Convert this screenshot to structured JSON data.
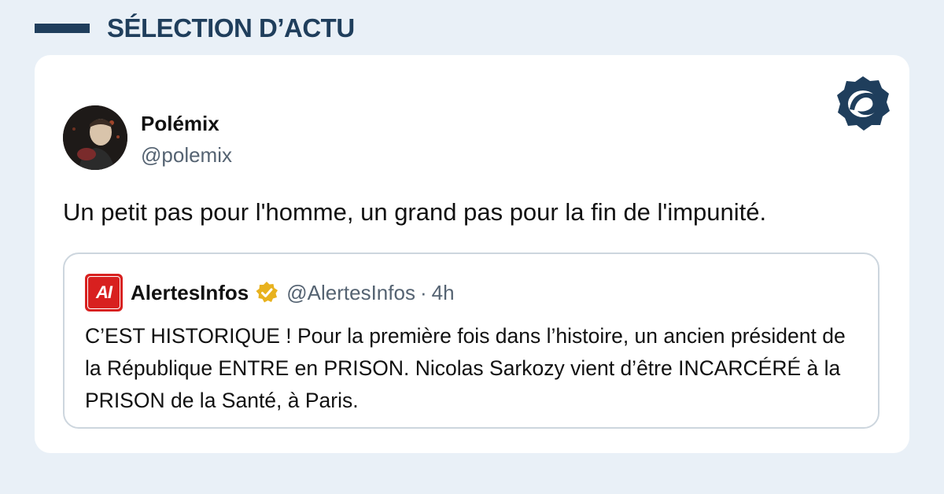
{
  "section": {
    "title": "SÉLECTION D’ACTU"
  },
  "post": {
    "author_name": "Polémix",
    "author_handle": "@polemix",
    "text": "Un petit pas pour l'homme, un grand pas pour la fin de l'impunité."
  },
  "quoted_post": {
    "avatar_text": "AI",
    "author_name": "AlertesInfos",
    "author_handle": "@AlertesInfos",
    "separator": "·",
    "time": "4h",
    "text": "C’EST HISTORIQUE ! Pour la première fois dans l’histoire, un ancien président de la République ENTRE en PRISON. Nicolas Sarkozy vient d’être INCARCÉRÉ à la PRISON de la Santé, à Paris."
  },
  "icons": {
    "brand_logo": "brand-logo-icon",
    "verified_badge": "verified-badge-icon"
  },
  "colors": {
    "background": "#e9f0f7",
    "accent": "#1f3e5c",
    "alert_red": "#d8201f",
    "verified_gold": "#e8b21f"
  }
}
